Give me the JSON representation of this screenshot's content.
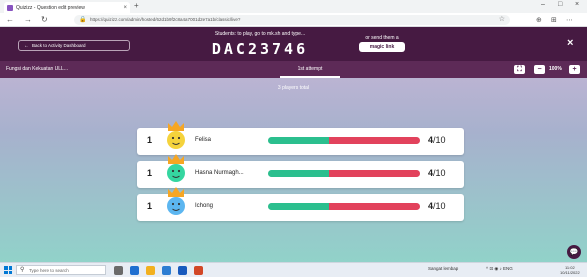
{
  "browser": {
    "tab_title": "Quizizz - Question edit preview",
    "tab_close": "×",
    "new_tab": "+",
    "window_controls": {
      "minimize": "–",
      "maximize": "□",
      "close": "×"
    },
    "nav": {
      "back": "←",
      "forward": "→",
      "reload": "↻"
    },
    "url": "https://quizizz.com/admin/hosted/62d1b9f2c8a4a7001d2e7a1b/classic/live?",
    "lock": "🔒",
    "star": "☆",
    "extensions": [
      "⊕",
      "⊞",
      "⋯"
    ]
  },
  "header": {
    "back_label": "Back to Activity Dashboard",
    "join_instruction": "Students: to play, go to mk.sh and type...",
    "join_code": "DAC23746",
    "send_label": "or send them a",
    "magic_link_label": "magic link",
    "close_label": "×"
  },
  "subbar": {
    "quiz_name": "Fungsi dan Kekuatan ULL...",
    "attempt_tab": "1st attempt",
    "expand_label": "⛶",
    "zoom_out_label": "−",
    "zoom_value": "100%",
    "zoom_in_label": "+"
  },
  "players_total": "3 players total",
  "players": [
    {
      "rank": "1",
      "name": "Felisa",
      "score": "4",
      "total": "/10",
      "correct_fraction": 0.4
    },
    {
      "rank": "1",
      "name": "Hasna Nurmagh...",
      "score": "4",
      "total": "/10",
      "correct_fraction": 0.4
    },
    {
      "rank": "1",
      "name": "Ichong",
      "score": "4",
      "total": "/10",
      "correct_fraction": 0.4
    }
  ],
  "colors": {
    "header": "#461a42",
    "subbar": "#5d2a57",
    "correct": "#2bbf8e",
    "incorrect": "#e2425c",
    "crown": "#f6a623",
    "avatar_1": "#f5d33c",
    "avatar_2": "#35d6a0",
    "avatar_3": "#5cb6f0"
  },
  "chat_icon": "💬",
  "taskbar": {
    "search_placeholder": "Type here to search",
    "search_glyph": "⚲",
    "weather": "Sangat lembap",
    "tray_icons": "^  ⊡  ◉  ♪  ENG",
    "time": "11:02",
    "date": "10/11/2022"
  }
}
